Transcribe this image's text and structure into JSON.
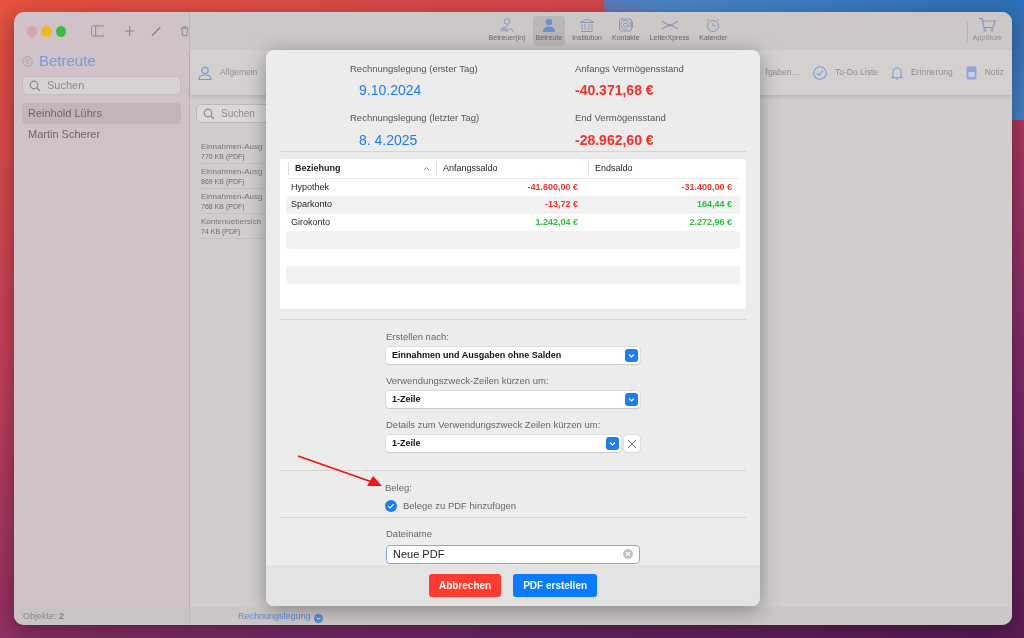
{
  "sidebar": {
    "title": "Betreute",
    "search": {
      "placeholder": "Suchen"
    },
    "items": [
      {
        "label": "Reinhold Lührs",
        "selected": true
      },
      {
        "label": "Martin Scherer",
        "selected": false
      }
    ],
    "footer": "Objekte: **2**"
  },
  "toolbar": {
    "items": [
      {
        "label": "Betreuer(in)",
        "selected": false
      },
      {
        "label": "Betreute",
        "selected": true
      },
      {
        "label": "Institution",
        "selected": false
      },
      {
        "label": "Kontakte",
        "selected": false
      },
      {
        "label": "LetterXpress",
        "selected": false
      },
      {
        "label": "Kalender",
        "selected": false
      }
    ],
    "store": "AppStore"
  },
  "tabs": [
    {
      "label": "Allgemein"
    },
    {
      "label": "fgaben…"
    },
    {
      "label": "To-Do Liste"
    },
    {
      "label": "Erinnerung"
    },
    {
      "label": "Notiz"
    }
  ],
  "files": {
    "search": {
      "placeholder": "Suchen"
    },
    "items": [
      {
        "name": "Einnahmen-Ausg",
        "size": "770 KB (PDF)"
      },
      {
        "name": "Einnahmen-Ausg",
        "size": "869 KB (PDF)"
      },
      {
        "name": "Einnahmen-Ausg",
        "size": "768 KB (PDF)"
      },
      {
        "name": "Kontenuebersich",
        "size": "74 KB (PDF)"
      }
    ],
    "footer_link": "Rechnungslegung"
  },
  "dialog": {
    "summary": [
      {
        "label": "Rechnungslegung (erster Tag)",
        "value": "9.10.2024",
        "color": "#1b7cf2"
      },
      {
        "label": "Anfangs Vermögensstand",
        "value": "-40.371,68 €",
        "color": "#f5302b"
      },
      {
        "label": "Rechnungslegung (letzter Tag)",
        "value": "8.  4.2025",
        "color": "#1b7cf2"
      },
      {
        "label": "End Vermögensstand",
        "value": "-28.962,60 €",
        "color": "#f5302b"
      }
    ],
    "table": {
      "columns": [
        {
          "label": "Beziehung",
          "sorted": true
        },
        {
          "label": "Anfangssaldo"
        },
        {
          "label": "Endsaldo"
        }
      ],
      "rows": [
        {
          "cells": [
            {
              "text": "Hypothek"
            },
            {
              "text": "-41.600,00 €",
              "color": "#f5302b"
            },
            {
              "text": "-31.400,00 €",
              "color": "#f5302b"
            }
          ]
        },
        {
          "cells": [
            {
              "text": "Sparkonto"
            },
            {
              "text": "-13,72 €",
              "color": "#f5302b"
            },
            {
              "text": "164,44 €",
              "color": "#27c23a"
            }
          ]
        },
        {
          "cells": [
            {
              "text": "Girokonto"
            },
            {
              "text": "1.242,04 €",
              "color": "#27c23a"
            },
            {
              "text": "2.272,96 €",
              "color": "#27c23a"
            }
          ]
        }
      ]
    },
    "fields": [
      {
        "label": "Erstellen nach:",
        "value": "Einnahmen und Ausgaben ohne Salden",
        "clearable": false
      },
      {
        "label": "Verwendungszweck-Zeilen kürzen um:",
        "value": "1-Zeile",
        "clearable": false
      },
      {
        "label": "Details zum Verwendungszweck Zeilen kürzen um:",
        "value": "1-Zeile",
        "clearable": true
      }
    ],
    "receipt": {
      "label": "Beleg:",
      "option": {
        "label": "Belege zu PDF hinzufügen",
        "checked": true
      }
    },
    "filename": {
      "label": "Dateiname",
      "value": "Neue PDF"
    },
    "buttons": [
      {
        "label": "Abbrechen",
        "kind": "cancel"
      },
      {
        "label": "PDF erstellen",
        "kind": "primary"
      }
    ]
  }
}
